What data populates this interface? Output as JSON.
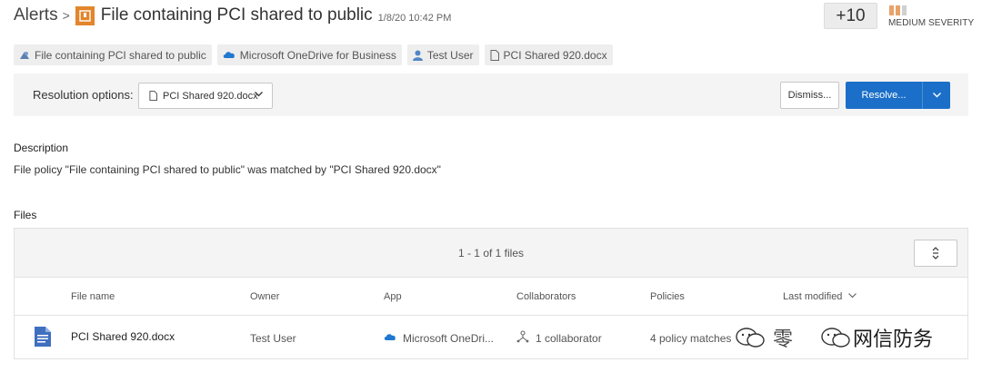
{
  "header": {
    "breadcrumb": "Alerts",
    "breadcrumb_sep": ">",
    "title": "File containing PCI shared to public",
    "timestamp": "1/8/20 10:42 PM",
    "plus_count": "+10",
    "severity_label": "MEDIUM SEVERITY",
    "severity_color": "#e8a26b"
  },
  "tags": [
    {
      "label": "File containing PCI shared to public",
      "icon": "policy-icon"
    },
    {
      "label": "Microsoft OneDrive for Business",
      "icon": "onedrive-icon"
    },
    {
      "label": "Test User",
      "icon": "user-icon"
    },
    {
      "label": "PCI Shared 920.docx",
      "icon": "document-icon"
    }
  ],
  "resolution": {
    "label": "Resolution options:",
    "selected": "PCI Shared 920.docx",
    "dismiss_label": "Dismiss...",
    "resolve_label": "Resolve...",
    "accent": "#1b6fc8"
  },
  "description": {
    "heading": "Description",
    "text": "File policy \"File containing PCI shared to public\" was matched by \"PCI Shared 920.docx\""
  },
  "files": {
    "heading": "Files",
    "count_text": "1 - 1 of 1 files",
    "columns": [
      "File name",
      "Owner",
      "App",
      "Collaborators",
      "Policies",
      "Last modified"
    ],
    "rows": [
      {
        "file_name": "PCI Shared 920.docx",
        "owner": "Test User",
        "app": "Microsoft OneDri...",
        "collaborators": "1 collaborator",
        "policies": "4 policy matches"
      }
    ]
  },
  "watermark": {
    "text_a": "零",
    "text_b": "网信防务"
  }
}
